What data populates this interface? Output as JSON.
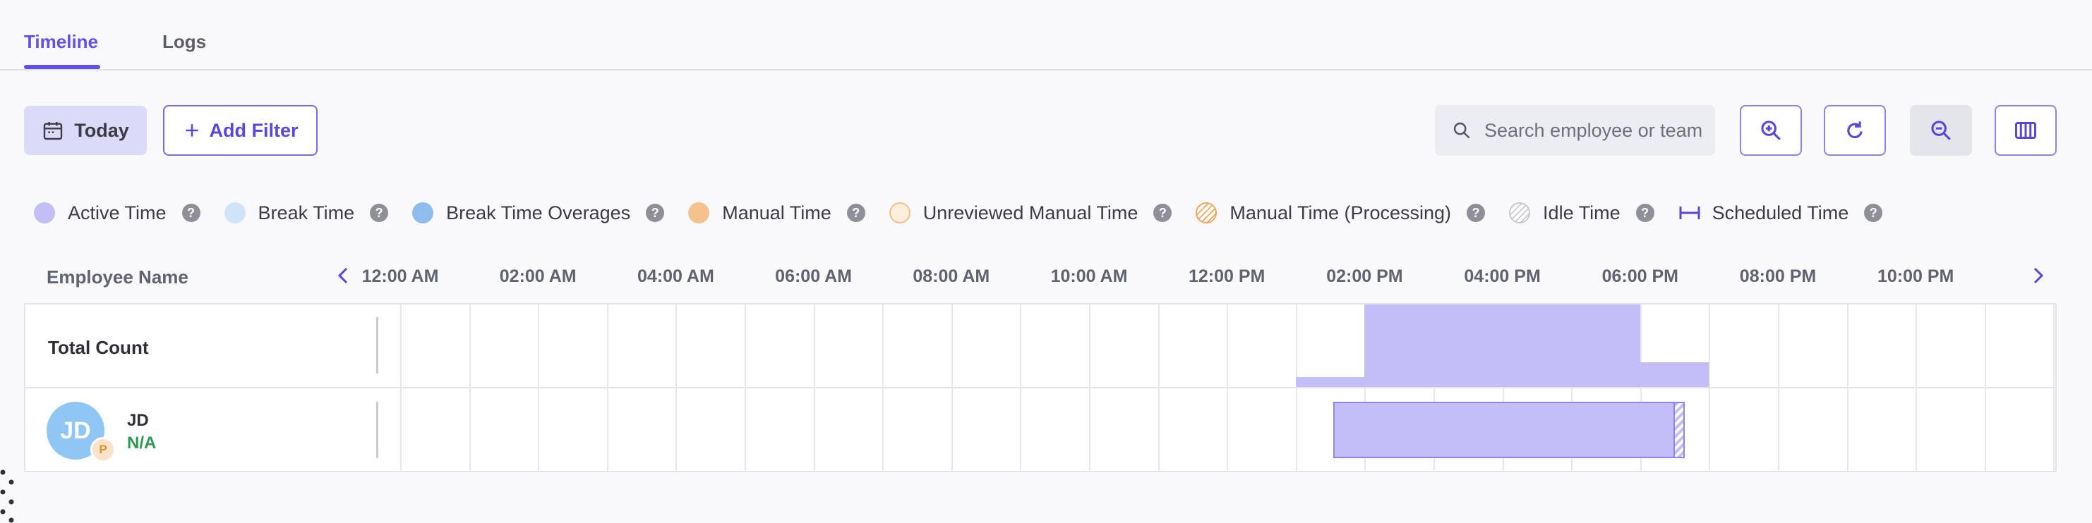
{
  "tabs": [
    {
      "label": "Timeline",
      "active": true
    },
    {
      "label": "Logs",
      "active": false
    }
  ],
  "toolbar": {
    "today_label": "Today",
    "add_filter_label": "Add Filter",
    "search_placeholder": "Search employee or team",
    "icons": [
      "zoom-in-icon",
      "refresh-icon",
      "zoom-out-icon",
      "columns-icon"
    ]
  },
  "legend": [
    {
      "label": "Active Time",
      "color": "#c3bef6"
    },
    {
      "label": "Break Time",
      "color": "#cfe4f8"
    },
    {
      "label": "Break Time Overages",
      "color": "#8fbcef"
    },
    {
      "label": "Manual Time",
      "color": "#f5c28e"
    },
    {
      "label": "Unreviewed Manual Time",
      "color": "#fdeedc"
    },
    {
      "label": "Manual Time (Processing)",
      "color": "#f3a55a"
    },
    {
      "label": "Idle Time",
      "color": "#d0d1d6"
    },
    {
      "label": "Scheduled Time",
      "color": "#5b46dd"
    }
  ],
  "legend_help": "?",
  "timeline": {
    "employee_header": "Employee Name",
    "hours": [
      "12:00 AM",
      "02:00 AM",
      "04:00 AM",
      "06:00 AM",
      "08:00 AM",
      "10:00 AM",
      "12:00 PM",
      "02:00 PM",
      "04:00 PM",
      "06:00 PM",
      "08:00 PM",
      "10:00 PM"
    ],
    "total_label": "Total Count",
    "total_bars": [
      {
        "start_hour": 13.0,
        "end_hour": 14.0,
        "level": 0.12
      },
      {
        "start_hour": 14.0,
        "end_hour": 18.0,
        "level": 1.0
      },
      {
        "start_hour": 18.0,
        "end_hour": 19.0,
        "level": 0.3
      }
    ],
    "employees": [
      {
        "initials": "JD",
        "badge": "P",
        "name": "JD",
        "status": "N/A",
        "active": {
          "start_hour": 13.55,
          "end_hour": 18.5
        },
        "idle": {
          "start_hour": 18.5,
          "end_hour": 18.65
        }
      }
    ]
  }
}
